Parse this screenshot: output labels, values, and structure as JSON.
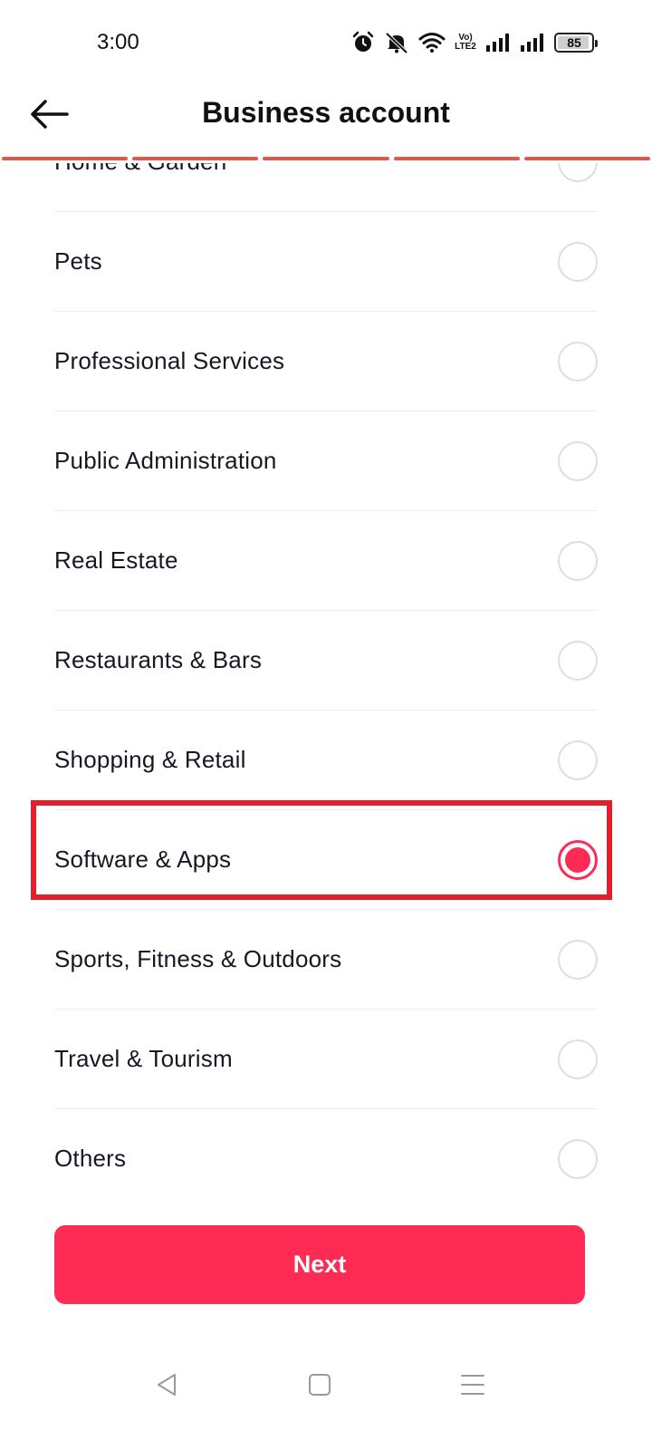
{
  "status_bar": {
    "time": "3:00",
    "volte_label": "Vo) LTE2",
    "battery_level": "85",
    "icons": [
      "alarm-icon",
      "mute-icon",
      "wifi-icon",
      "volte-icon",
      "signal-icon",
      "signal-icon",
      "battery-icon"
    ]
  },
  "header": {
    "title": "Business account",
    "back_icon": "arrow-left-icon"
  },
  "progress": {
    "steps_total": 5,
    "accent_color": "#e0584a"
  },
  "categories": [
    {
      "label": "Home & Garden",
      "selected": false
    },
    {
      "label": "Pets",
      "selected": false
    },
    {
      "label": "Professional Services",
      "selected": false
    },
    {
      "label": "Public Administration",
      "selected": false
    },
    {
      "label": "Real Estate",
      "selected": false
    },
    {
      "label": "Restaurants & Bars",
      "selected": false
    },
    {
      "label": "Shopping & Retail",
      "selected": false
    },
    {
      "label": "Software & Apps",
      "selected": true
    },
    {
      "label": "Sports, Fitness & Outdoors",
      "selected": false
    },
    {
      "label": "Travel & Tourism",
      "selected": false
    },
    {
      "label": "Others",
      "selected": false
    }
  ],
  "next_button": {
    "label": "Next",
    "color": "#fe2c55"
  },
  "nav_bar": {
    "icons": [
      "back-triangle-icon",
      "home-square-icon",
      "menu-lines-icon"
    ]
  }
}
